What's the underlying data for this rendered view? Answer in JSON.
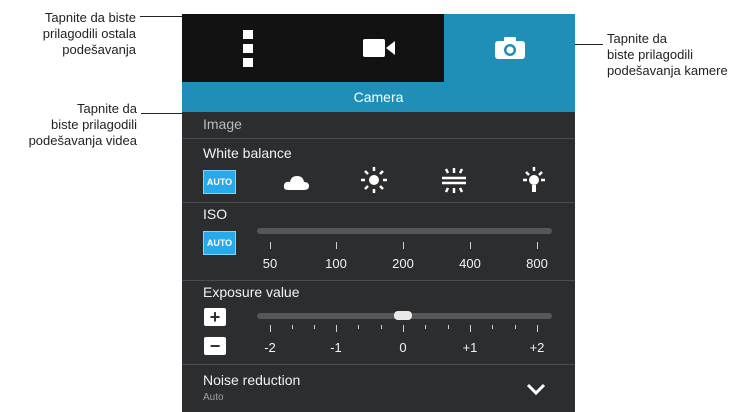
{
  "callouts": {
    "settings": "Tapnite da biste prilagodili ostala podešavanja",
    "video": "Tapnite da biste prilagodili podešavanja videa",
    "camera": "Tapnite da biste prilagodili podešavanja kamere",
    "settings_lines": [
      "Tapnite da biste",
      "prilagodili ostala",
      "podešavanja"
    ],
    "video_lines": [
      "Tapnite da",
      "biste prilagodili",
      "podešavanja videa"
    ],
    "camera_lines": [
      "Tapnite da",
      "biste prilagodili",
      "podešavanja kamere"
    ]
  },
  "tabs": [
    {
      "icon": "more-settings-icon",
      "active": false
    },
    {
      "icon": "video-camera-icon",
      "active": false
    },
    {
      "icon": "camera-icon",
      "active": true
    }
  ],
  "header": {
    "title": "Camera"
  },
  "section": {
    "label": "Image"
  },
  "white_balance": {
    "title": "White balance",
    "auto_label": "AUTO",
    "options": [
      "cloudy-icon",
      "daylight-icon",
      "fluorescent-icon",
      "incandescent-icon"
    ]
  },
  "iso": {
    "title": "ISO",
    "auto_label": "AUTO",
    "ticks": [
      "50",
      "100",
      "200",
      "400",
      "800"
    ]
  },
  "exposure": {
    "title": "Exposure value",
    "plus_label": "+",
    "minus_label": "−",
    "ticks": [
      "-2",
      "-1",
      "0",
      "+1",
      "+2"
    ],
    "value": 0
  },
  "noise": {
    "title": "Noise reduction",
    "value": "Auto",
    "expand_icon": "chevron-down-icon"
  },
  "colors": {
    "accent": "#1f8fb8",
    "auto_badge": "#28a9ea",
    "panel": "#2c2d2f"
  }
}
